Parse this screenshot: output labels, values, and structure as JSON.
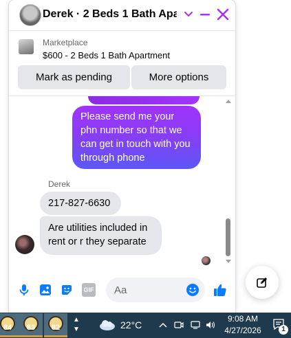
{
  "header": {
    "title": "Derek · 2 Beds 1 Bath Apar…"
  },
  "listing": {
    "source": "Marketplace",
    "summary": "$600 - 2 Beds 1 Bath Apartment"
  },
  "actions": {
    "pending_label": "Mark as pending",
    "more_label": "More options"
  },
  "messages": {
    "outgoing": "Please send me your phn number so that we can get in touch with you through phone",
    "sender_name": "Derek",
    "incoming": [
      "217-827-6630",
      "Are utilities included in rent or r they separate"
    ]
  },
  "composer": {
    "placeholder": "Aa",
    "gif_label": "GIF"
  },
  "taskbar": {
    "apps": [
      "84",
      "83",
      "82"
    ],
    "temperature": "22°C",
    "time": "9:08 AM",
    "date": "4/27/2026",
    "notification_count": "1"
  },
  "colors": {
    "accent": "#a033ff",
    "messenger_blue": "#0a7cff",
    "taskbar": "#1f3a4c"
  }
}
